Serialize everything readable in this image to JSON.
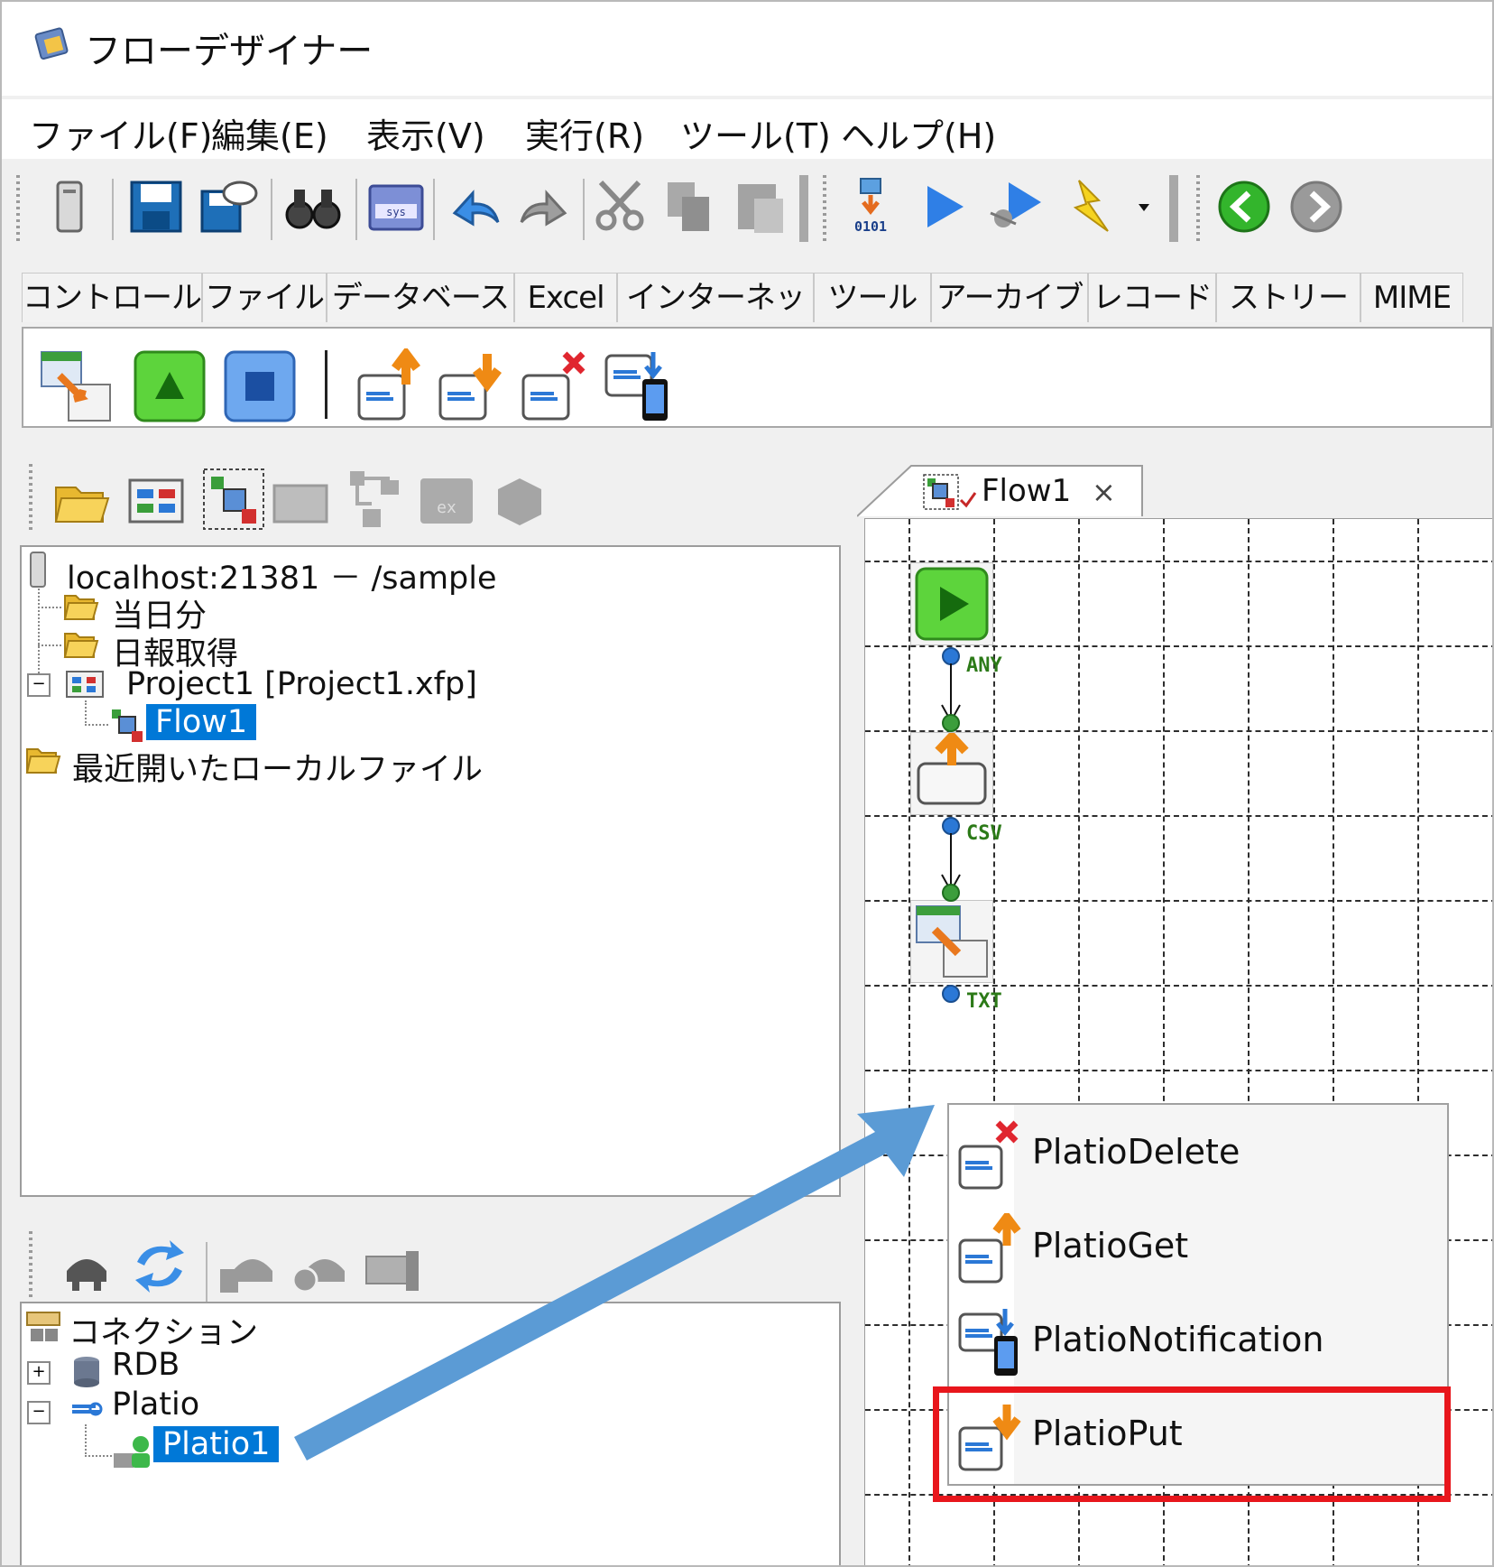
{
  "window": {
    "title": "フローデザイナー"
  },
  "menu": [
    "ファイル(F)",
    "編集(E)",
    "表示(V)",
    "実行(R)",
    "ツール(T)",
    "ヘルプ(H)"
  ],
  "toolbar": {
    "icons": [
      "server-icon",
      "save-icon",
      "save-as-icon",
      "find-icon",
      "sys-icon",
      "undo-icon",
      "redo-icon",
      "cut-icon",
      "copy-icon",
      "paste-icon",
      "compile-icon",
      "run-icon",
      "debug-icon",
      "lightning-icon",
      "dropdown-icon",
      "back-icon",
      "forward-icon"
    ],
    "compile_label": "0101"
  },
  "category_tabs": [
    "コントロール",
    "ファイル",
    "データベース",
    "Excel",
    "インターネット",
    "ツール",
    "アーカイブ",
    "レコード",
    "ストリーム",
    "MIME"
  ],
  "tree": {
    "root": "localhost:21381 － /sample",
    "items": [
      {
        "label": "当日分",
        "type": "folder"
      },
      {
        "label": "日報取得",
        "type": "folder"
      },
      {
        "label": "Project1 [Project1.xfp]",
        "type": "project"
      },
      {
        "label": "Flow1",
        "type": "flow",
        "selected": true
      },
      {
        "label": "最近開いたローカルファイル",
        "type": "folder"
      }
    ]
  },
  "connections": {
    "root": "コネクション",
    "items": [
      {
        "label": "RDB",
        "expander": "+"
      },
      {
        "label": "Platio",
        "expander": "−"
      },
      {
        "label": "Platio1",
        "selected": true
      }
    ]
  },
  "flow_tab": {
    "label": "Flow1",
    "close": "×"
  },
  "flow_ports": [
    "ANY",
    "CSV",
    "TXT"
  ],
  "context_menu": [
    "PlatioDelete",
    "PlatioGet",
    "PlatioNotification",
    "PlatioPut"
  ],
  "colors": {
    "selection": "#0078d7",
    "highlight": "#e8161c",
    "arrow": "#5b9bd5",
    "port": "#2c7a18"
  }
}
